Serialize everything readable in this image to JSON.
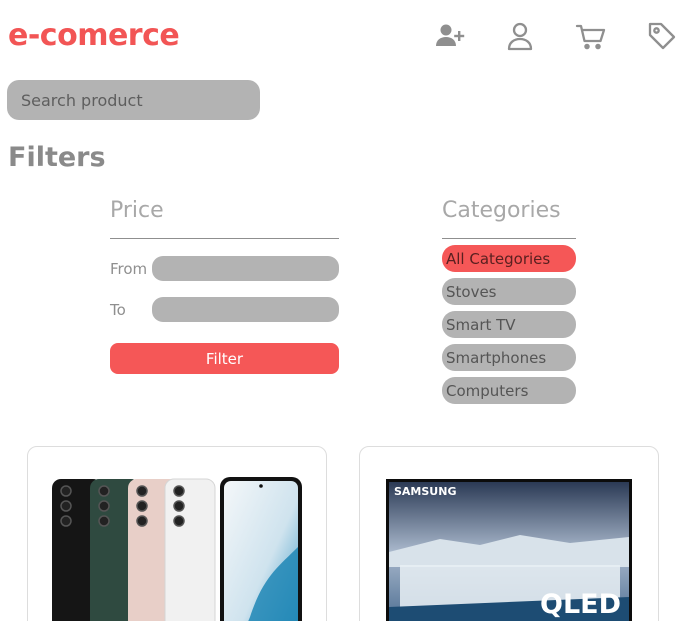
{
  "brand": {
    "name": "e-comerce"
  },
  "header": {
    "icons": [
      {
        "name": "add-user-icon"
      },
      {
        "name": "user-icon"
      },
      {
        "name": "cart-icon"
      },
      {
        "name": "tag-icon"
      }
    ]
  },
  "search": {
    "placeholder": "Search product",
    "value": ""
  },
  "filters": {
    "title": "Filters",
    "price": {
      "title": "Price",
      "from_label": "From",
      "to_label": "To",
      "from_value": "",
      "to_value": "",
      "button_label": "Filter"
    },
    "categories": {
      "title": "Categories",
      "items": [
        {
          "label": "All Categories",
          "active": true
        },
        {
          "label": "Stoves",
          "active": false
        },
        {
          "label": "Smart TV",
          "active": false
        },
        {
          "label": "Smartphones",
          "active": false
        },
        {
          "label": "Computers",
          "active": false
        }
      ]
    }
  },
  "products": [
    {
      "image": "smartphones-image"
    },
    {
      "image": "qled-tv-image",
      "brand_text": "SAMSUNG",
      "model_text": "QLED"
    }
  ],
  "colors": {
    "accent": "#f55757",
    "field": "#b3b3b3",
    "muted_text": "#8a8a8a"
  }
}
